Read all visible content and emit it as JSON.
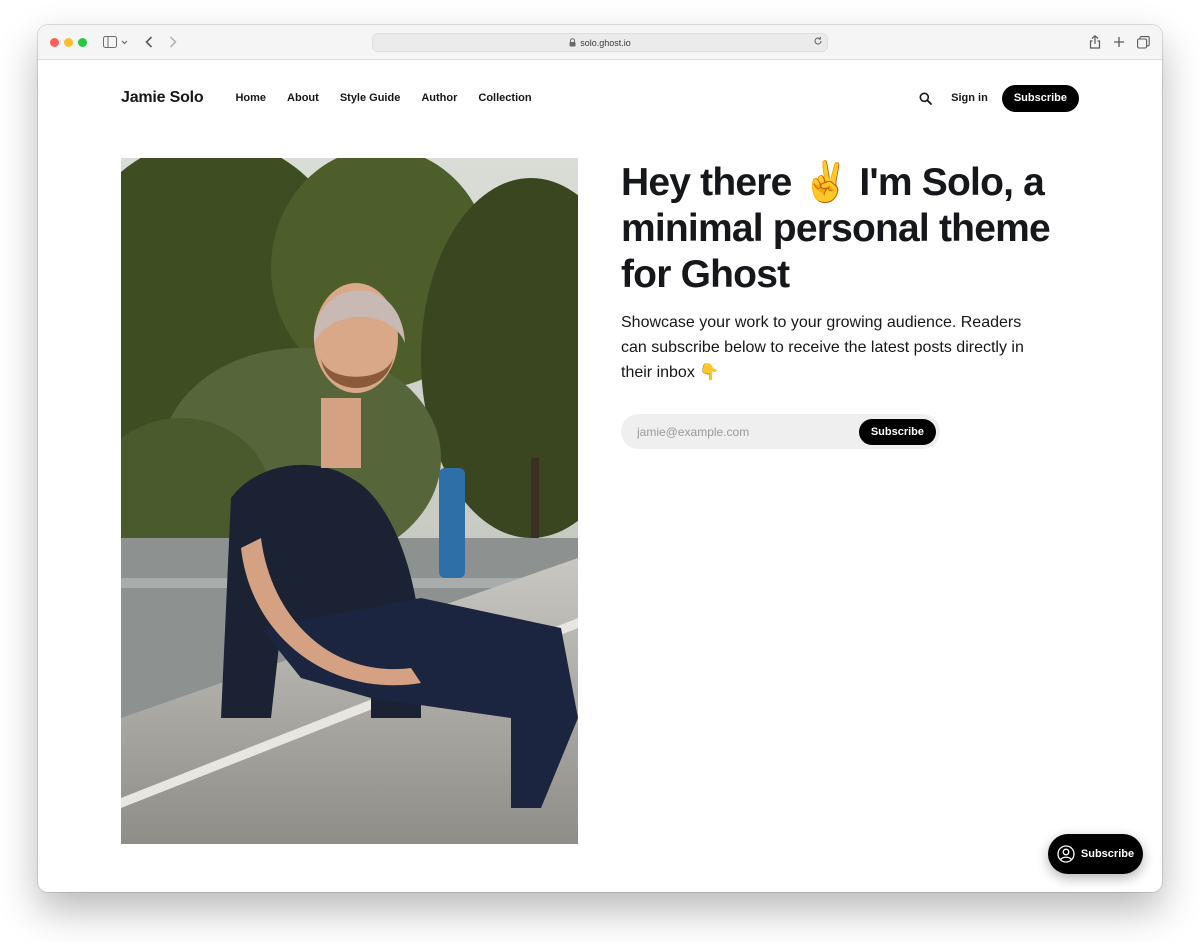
{
  "browser": {
    "url": "solo.ghost.io"
  },
  "site": {
    "title": "Jamie Solo",
    "nav": [
      {
        "label": "Home"
      },
      {
        "label": "About"
      },
      {
        "label": "Style Guide"
      },
      {
        "label": "Author"
      },
      {
        "label": "Collection"
      }
    ],
    "signin_label": "Sign in",
    "subscribe_label": "Subscribe"
  },
  "hero": {
    "title": "Hey there ✌️ I'm Solo, a minimal personal theme for Ghost",
    "description": "Showcase your work to your growing audience. Readers can subscribe below to receive the latest posts directly in their inbox 👇",
    "email_placeholder": "jamie@example.com",
    "form_button_label": "Subscribe"
  },
  "portal": {
    "label": "Subscribe"
  },
  "colors": {
    "accent": "#000000",
    "text": "#15171a"
  }
}
